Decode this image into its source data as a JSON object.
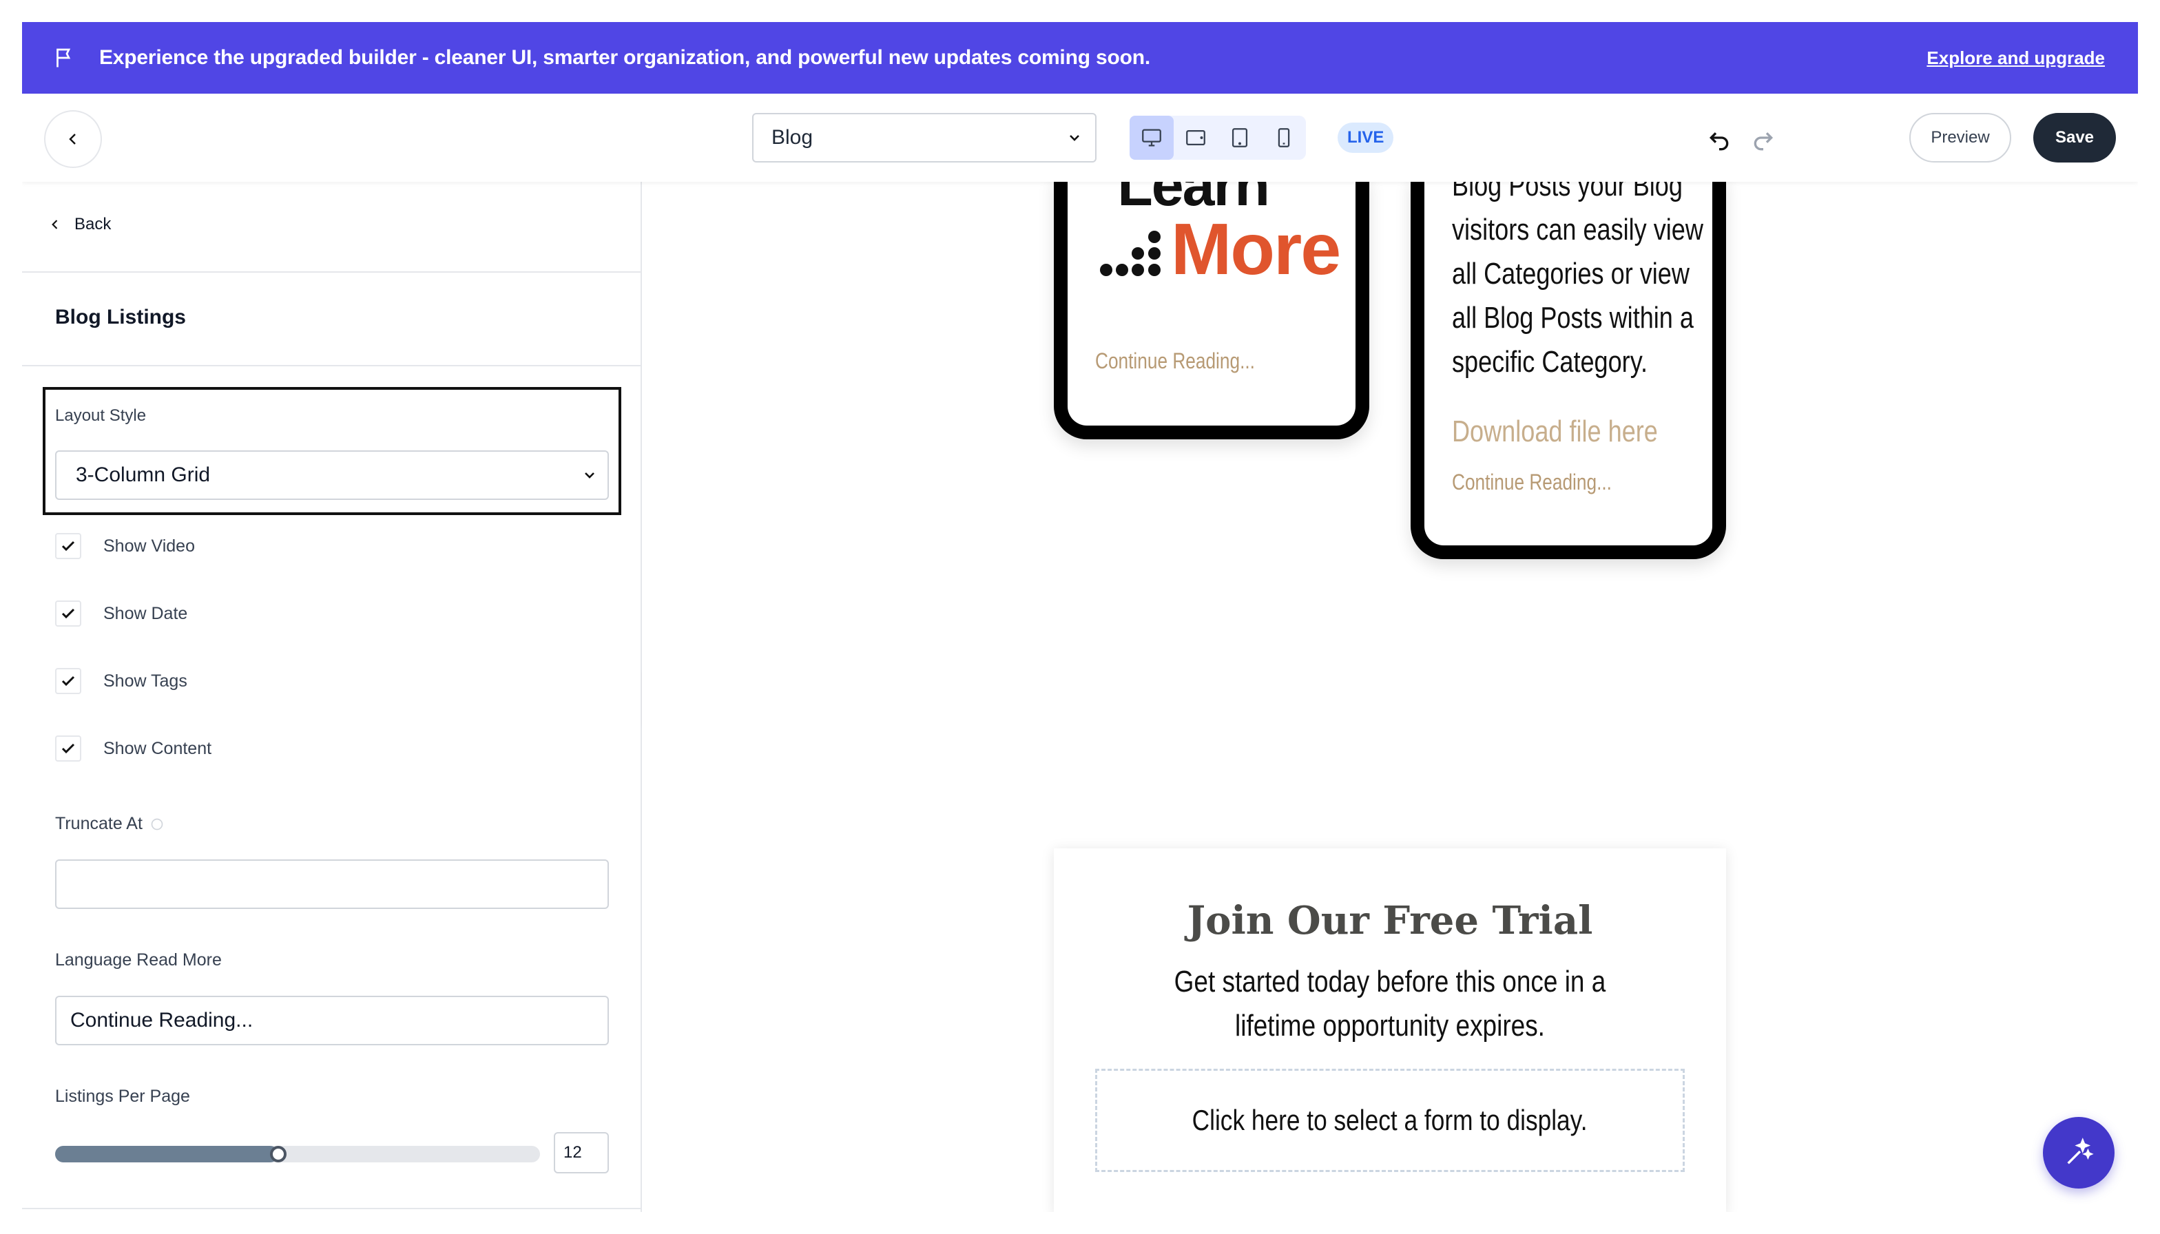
{
  "banner": {
    "message": "Experience the upgraded builder - cleaner UI, smarter organization, and powerful new updates coming soon.",
    "link": "Explore and upgrade",
    "icon": "flag-icon"
  },
  "toolbar": {
    "page_select": "Blog",
    "devices": [
      "desktop-icon",
      "tablet-landscape-icon",
      "tablet-icon",
      "mobile-icon"
    ],
    "active_device": "desktop",
    "live_badge": "LIVE",
    "preview_label": "Preview",
    "save_label": "Save"
  },
  "sidebar": {
    "back_label": "Back",
    "title": "Blog Listings",
    "layout_style_label": "Layout Style",
    "layout_style_value": "3-Column Grid",
    "checkboxes": [
      {
        "label": "Show Video",
        "checked": true
      },
      {
        "label": "Show Date",
        "checked": true
      },
      {
        "label": "Show Tags",
        "checked": true
      },
      {
        "label": "Show Content",
        "checked": true
      }
    ],
    "truncate_label": "Truncate At",
    "truncate_value": "",
    "read_more_label": "Language Read More",
    "read_more_value": "Continue Reading...",
    "listings_label": "Listings Per Page",
    "listings_value": "12",
    "listings_slider_fraction": 0.46
  },
  "canvas": {
    "card1": {
      "learn_text": "Learn",
      "more_text": "More",
      "continue": "Continue Reading..."
    },
    "card2": {
      "body_lines": [
        "Blog Posts your Blog",
        "visitors can easily view",
        "all Categories or view",
        "all Blog Posts within a",
        "specific Category."
      ],
      "download": "Download file here",
      "continue": "Continue Reading..."
    },
    "trial": {
      "title": "Join Our Free Trial",
      "subtitle": "Get started today before this once in a lifetime opportunity expires.",
      "form_placeholder": "Click here to select a form to display."
    }
  },
  "colors": {
    "banner": "#5046e5",
    "accent_orange": "#e0552d",
    "link_tan": "#b79a74",
    "save_dark": "#1f2937"
  }
}
